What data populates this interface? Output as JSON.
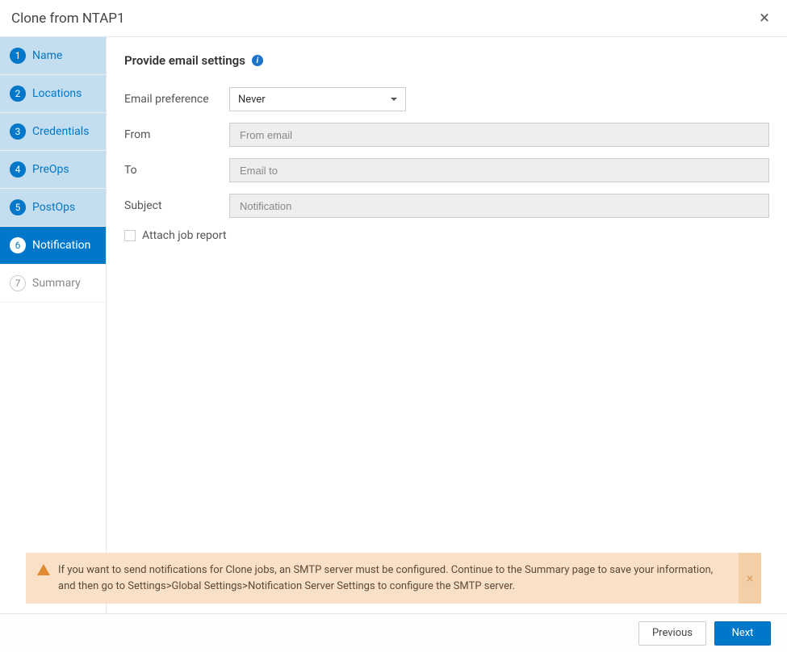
{
  "header": {
    "title": "Clone from NTAP1"
  },
  "sidebar": {
    "steps": [
      {
        "num": "1",
        "label": "Name",
        "state": "completed"
      },
      {
        "num": "2",
        "label": "Locations",
        "state": "completed"
      },
      {
        "num": "3",
        "label": "Credentials",
        "state": "completed"
      },
      {
        "num": "4",
        "label": "PreOps",
        "state": "completed"
      },
      {
        "num": "5",
        "label": "PostOps",
        "state": "completed"
      },
      {
        "num": "6",
        "label": "Notification",
        "state": "active"
      },
      {
        "num": "7",
        "label": "Summary",
        "state": "upcoming"
      }
    ]
  },
  "main": {
    "heading": "Provide email settings",
    "labels": {
      "email_pref": "Email preference",
      "from": "From",
      "to": "To",
      "subject": "Subject",
      "attach": "Attach job report"
    },
    "values": {
      "email_pref": "Never",
      "subject": "Notification"
    },
    "placeholders": {
      "from": "From email",
      "to": "Email to"
    }
  },
  "warning": {
    "text": "If you want to send notifications for Clone jobs, an SMTP server must be configured. Continue to the Summary page to save your information, and then go to Settings>Global Settings>Notification Server Settings to configure the SMTP server."
  },
  "footer": {
    "previous": "Previous",
    "next": "Next"
  }
}
